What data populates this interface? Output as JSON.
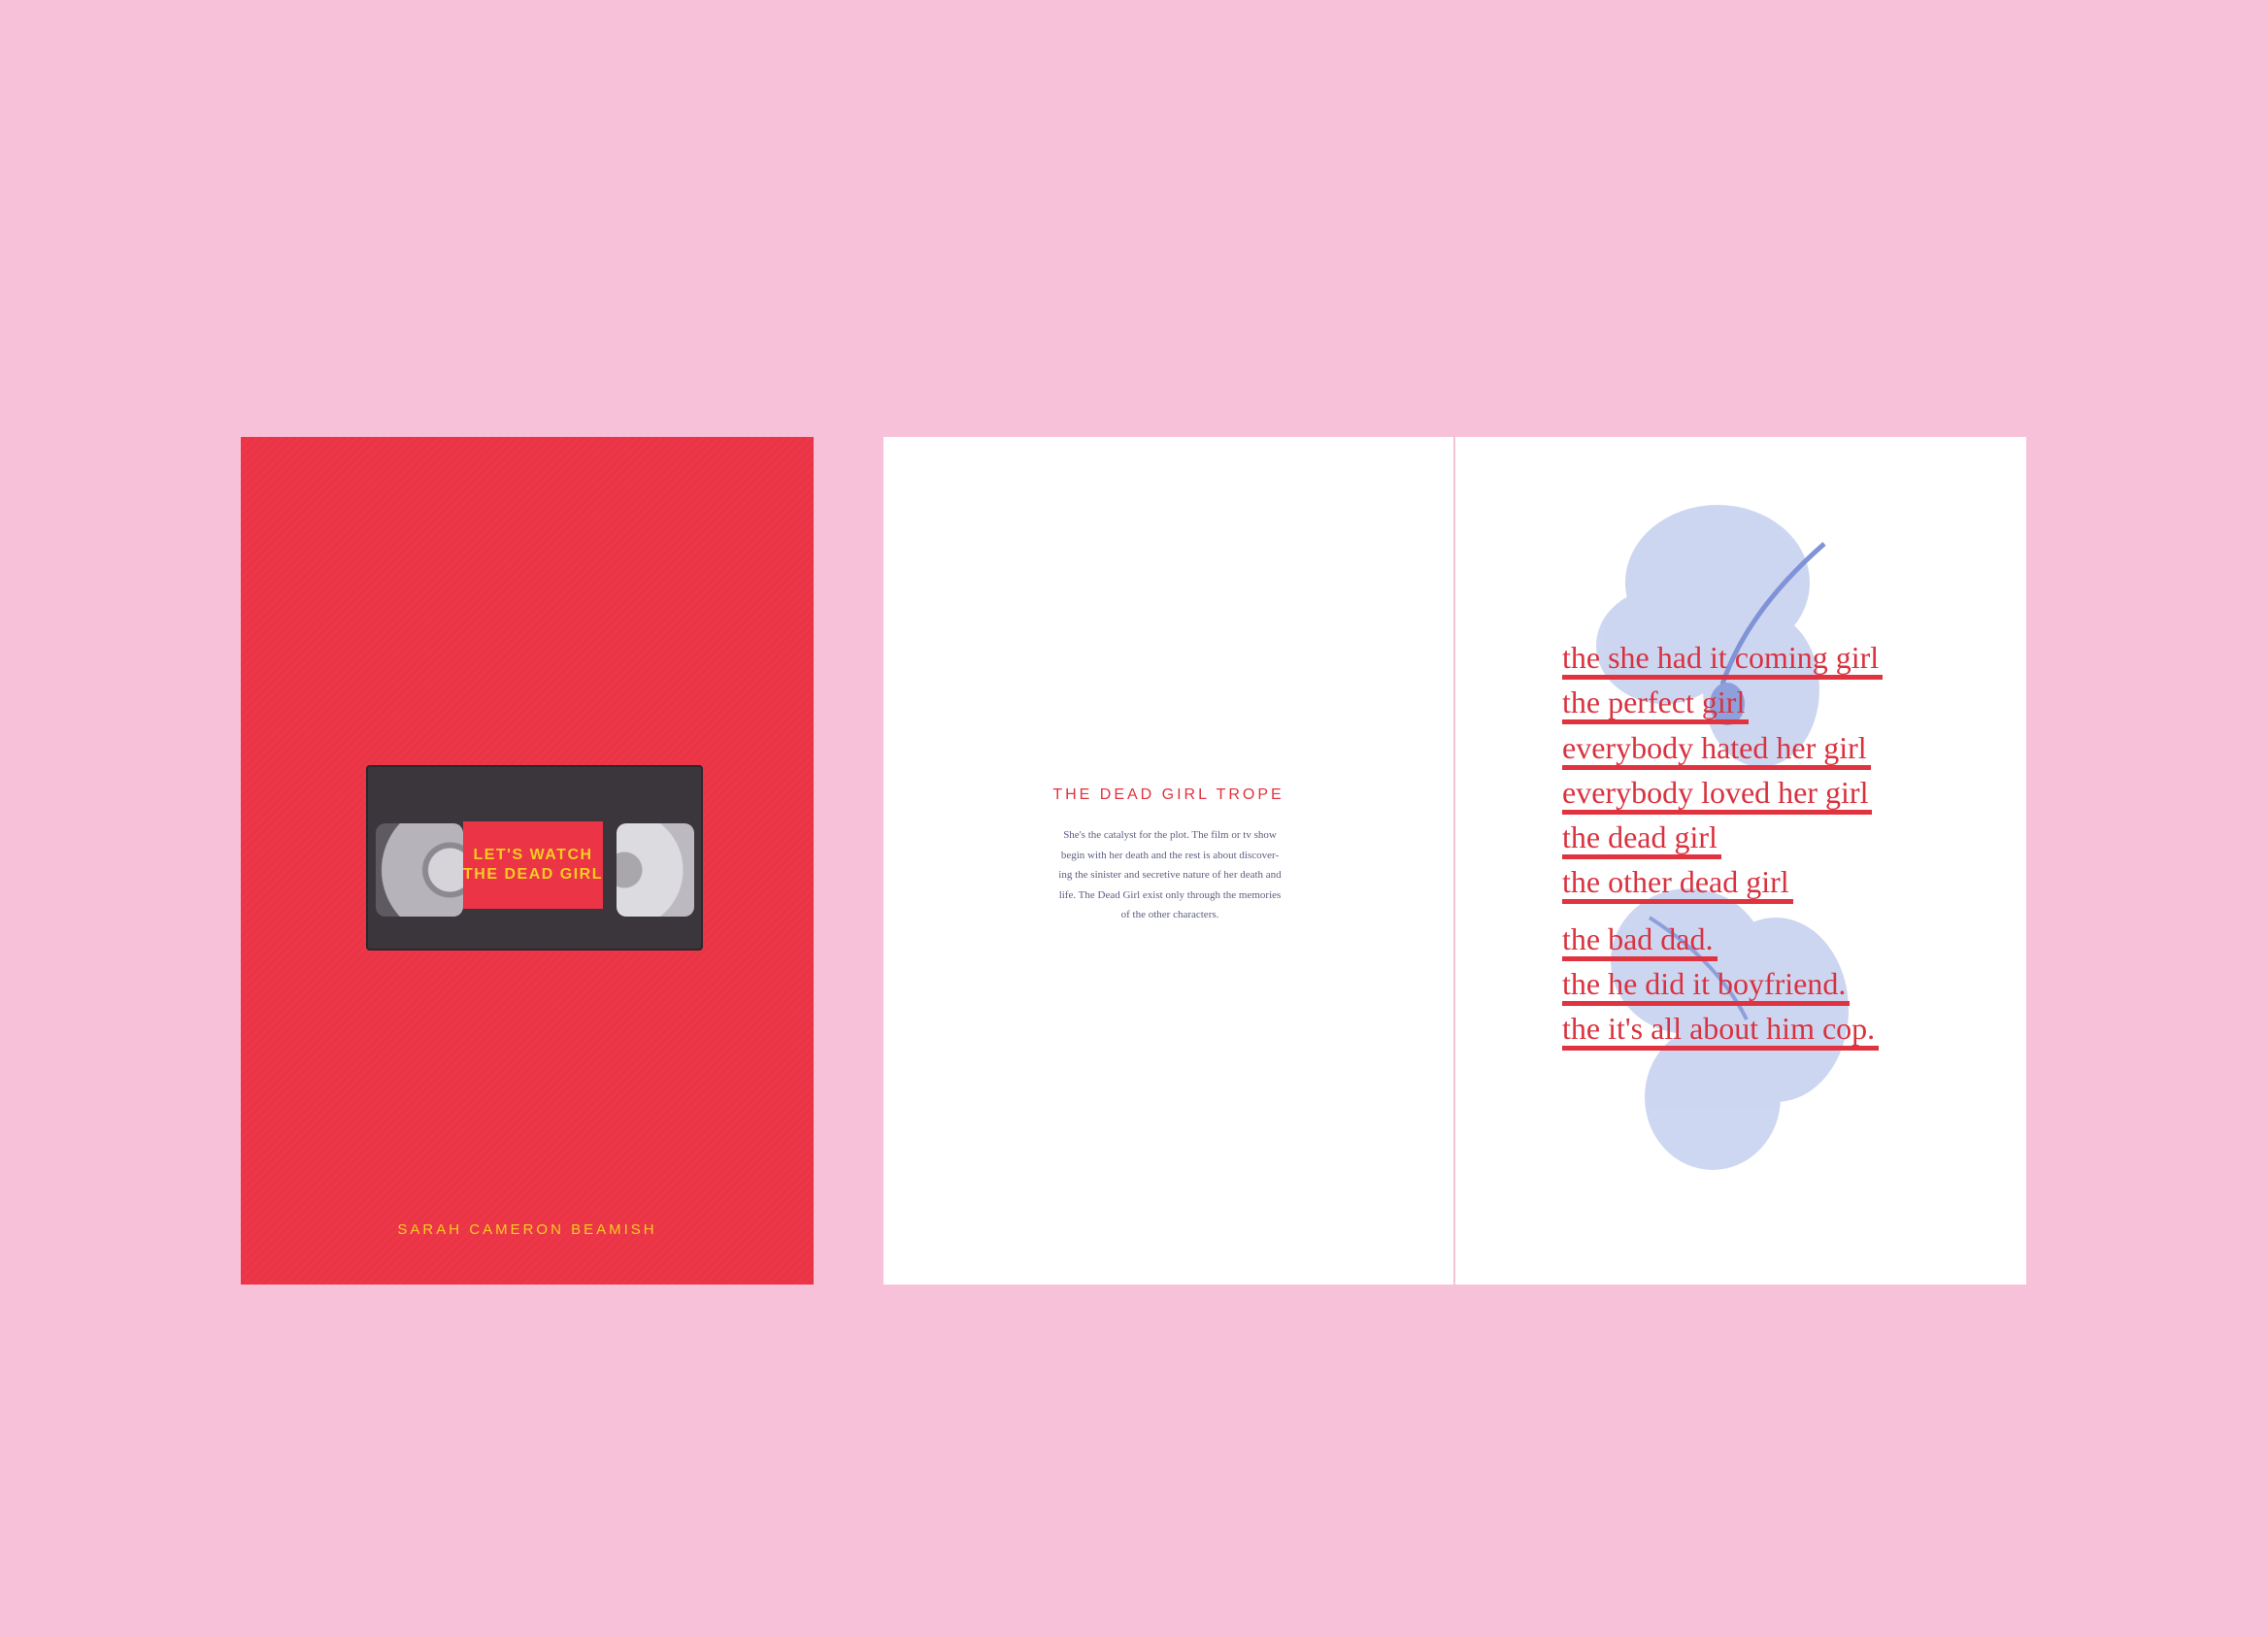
{
  "cover": {
    "vhs_label": [
      "LET'S WATCH",
      "THE DEAD GIRL"
    ],
    "author": "SARAH CAMERON BEAMISH",
    "color": "#eb3446"
  },
  "middle": {
    "title": "THE DEAD GIRL TROPE",
    "body": [
      "She's the catalyst for the plot. The film or tv show",
      "begin with her death and the rest is about discover-",
      "ing the sinister and secretive nature of her death and",
      "life. The Dead Girl exist only through the memories",
      "of the other characters."
    ]
  },
  "right": {
    "group1": [
      "the she had it coming girl",
      "the perfect girl",
      "everybody hated her girl",
      "everybody loved her girl",
      "the dead girl",
      "the other dead girl"
    ],
    "group2": [
      "the bad dad.",
      "the he did it boyfriend.",
      "the it's all about him cop."
    ]
  }
}
